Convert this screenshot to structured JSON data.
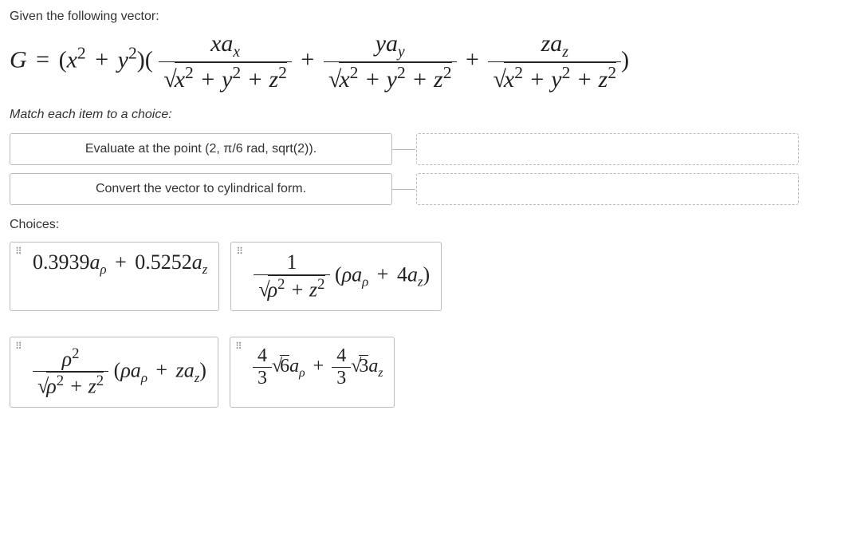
{
  "intro": "Given the following vector:",
  "main_equation": "G = (x² + y²)( xa_x / √(x²+y²+z²) + ya_y / √(x²+y²+z²) + za_z / √(x²+y²+z²) )",
  "instruction": "Match each item to a choice:",
  "match_items": [
    "Evaluate at the point (2, π/6 rad, sqrt(2)).",
    "Convert the vector to cylindrical form."
  ],
  "choices_label": "Choices:",
  "choices": {
    "a": "0.3939a_ρ + 0.5252a_z",
    "b": "1/√(ρ²+z²) (ρa_ρ + 4a_z)",
    "c": "ρ²/√(ρ²+z²) (ρa_ρ + za_z)",
    "d": "(4/3)√6 a_ρ + (4/3)√3 a_z"
  }
}
